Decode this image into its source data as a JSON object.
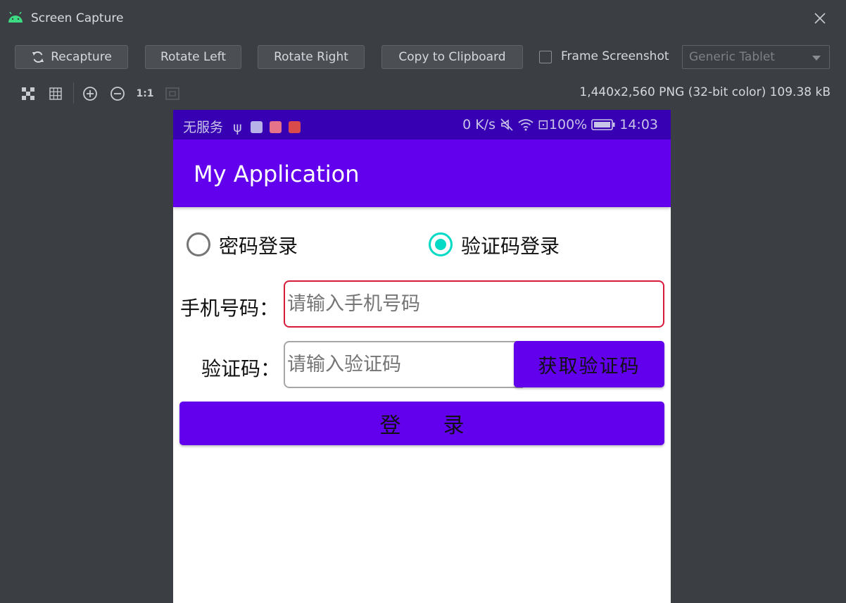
{
  "window": {
    "title": "Screen Capture",
    "icon": "android-icon"
  },
  "toolbar": {
    "recapture_label": "Recapture",
    "rotate_left_label": "Rotate Left",
    "rotate_right_label": "Rotate Right",
    "copy_label": "Copy to Clipboard",
    "frame_label": "Frame Screenshot",
    "frame_checked": false,
    "device_select": "Generic Tablet"
  },
  "view_tools": {
    "actual_size_label": "1:1",
    "info": "1,440x2,560 PNG (32-bit color) 109.38 kB"
  },
  "device": {
    "status_left": "无服务",
    "status_speed": "0 K/s",
    "status_battery": "100%",
    "status_time": "14:03",
    "app_title": "My Application",
    "radio_password": "密码登录",
    "radio_sms": "验证码登录",
    "selected_radio": "验证码登录",
    "phone_label": "手机号码：",
    "phone_placeholder": "请输入手机号码",
    "code_label": "验证码：",
    "code_placeholder": "请输入验证码",
    "get_code_label": "获取验证码",
    "login_label": "登　　录",
    "colors": {
      "status_bar": "#3700b3",
      "primary": "#6200ee",
      "accent": "#03dac5",
      "focus_border": "#d81b3b"
    }
  }
}
